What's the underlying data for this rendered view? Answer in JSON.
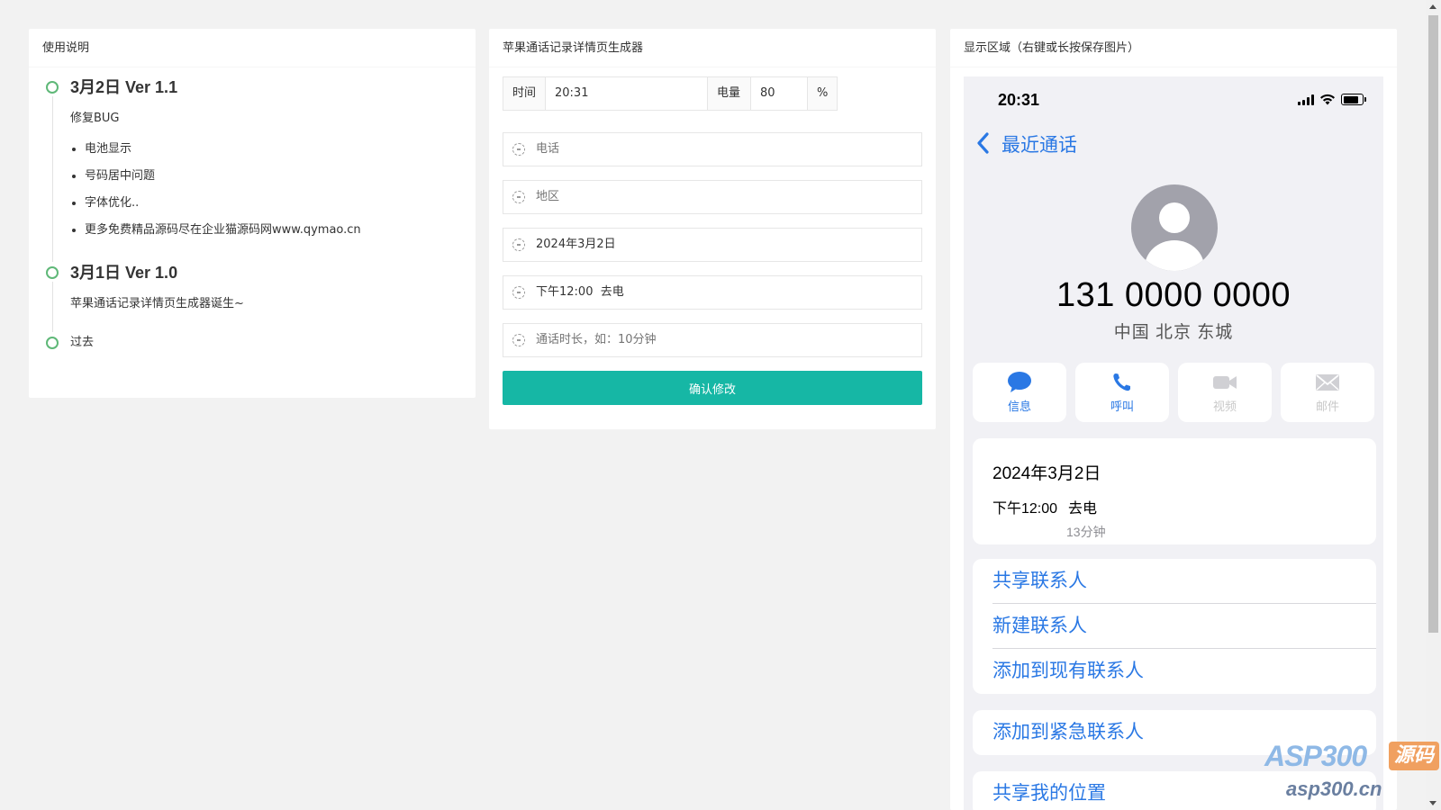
{
  "left_card": {
    "title": "使用说明",
    "timeline": [
      {
        "title": "3月2日 Ver 1.1",
        "text": "修复BUG",
        "list": [
          "电池显示",
          "号码居中问题",
          "字体优化..",
          "更多免费精品源码尽在企业猫源码网www.qymao.cn"
        ]
      },
      {
        "title": "3月1日 Ver 1.0",
        "text": "苹果通话记录详情页生成器诞生~"
      },
      {
        "plain": "过去"
      }
    ]
  },
  "mid_card": {
    "title": "苹果通话记录详情页生成器",
    "time_label": "时间",
    "time_value": "20:31",
    "battery_label": "电量",
    "battery_value": "80",
    "percent_sign": "%",
    "fields": {
      "phone_placeholder": "电话",
      "region_placeholder": "地区",
      "date_value": "2024年3月2日",
      "call_value": "下午12:00  去电",
      "duration_placeholder": "通话时长，如：10分钟"
    },
    "confirm_label": "确认修改"
  },
  "right_card": {
    "title": "显示区域（右键或长按保存图片）",
    "phone": {
      "status_time": "20:31",
      "battery_level": 0.8,
      "back_label": "最近通话",
      "number": "131 0000 0000",
      "location": "中国 北京 东城",
      "actions": [
        {
          "label": "信息",
          "icon": "message-icon",
          "enabled": true
        },
        {
          "label": "呼叫",
          "icon": "phone-icon",
          "enabled": true
        },
        {
          "label": "视频",
          "icon": "video-icon",
          "enabled": false
        },
        {
          "label": "邮件",
          "icon": "mail-icon",
          "enabled": false
        }
      ],
      "call": {
        "date": "2024年3月2日",
        "time": "下午12:00",
        "type": "去电",
        "duration": "13分钟"
      },
      "menu": {
        "share_contact": "共享联系人",
        "new_contact": "新建联系人",
        "add_existing": "添加到现有联系人",
        "add_emergency": "添加到紧急联系人",
        "share_location": "共享我的位置"
      }
    }
  },
  "watermark": {
    "logo_text": "ASP300",
    "badge_text": "源码",
    "url": "asp300.cn"
  },
  "colors": {
    "accent_teal": "#16b7a5",
    "ios_blue": "#2a78e4",
    "timeline_green": "#5fb878"
  }
}
